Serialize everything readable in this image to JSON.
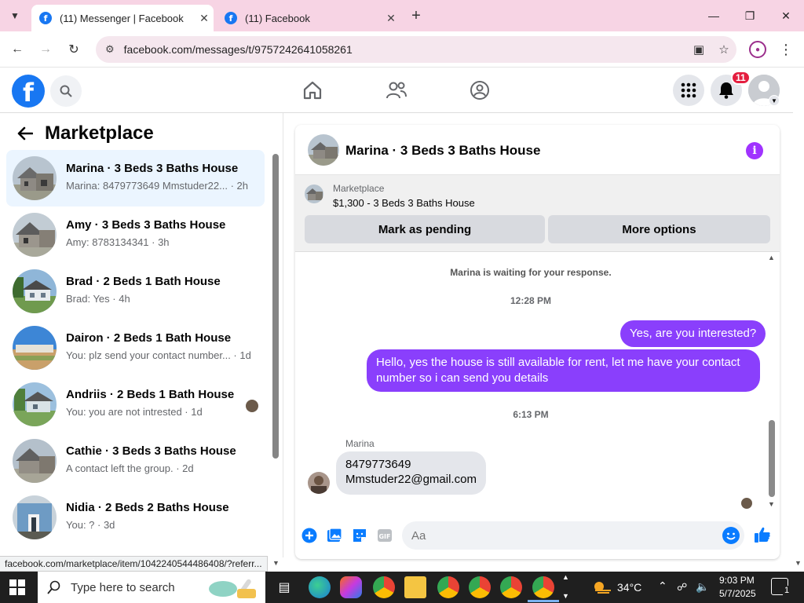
{
  "browser": {
    "tabs": [
      {
        "title": "(11) Messenger | Facebook",
        "active": true
      },
      {
        "title": "(11) Facebook",
        "active": false
      }
    ],
    "url": "facebook.com/messages/t/9757242641058261",
    "status_url": "facebook.com/marketplace/item/1042240544486408/?referr..."
  },
  "facebook": {
    "notification_count": "11"
  },
  "left_panel": {
    "title": "Marketplace",
    "conversations": [
      {
        "title": "Marina · 3 Beds 3 Baths House",
        "preview": "Marina: 8479773649 Mmstuder22... · 2h",
        "selected": true
      },
      {
        "title": "Amy · 3 Beds 3 Baths House",
        "preview": "Amy: 8783134341 · 3h"
      },
      {
        "title": "Brad · 2 Beds 1 Bath House",
        "preview": "Brad: Yes · 4h"
      },
      {
        "title": "Dairon · 2 Beds 1 Bath House",
        "preview": "You: plz send your contact number... · 1d"
      },
      {
        "title": "Andriis · 2 Beds 1 Bath House",
        "preview": "You: you are not intrested · 1d"
      },
      {
        "title": "Cathie · 3 Beds 3 Baths House",
        "preview": "A contact left the group. · 2d"
      },
      {
        "title": "Nidia · 2 Beds 2 Baths House",
        "preview": "You: ? · 3d"
      }
    ]
  },
  "chat": {
    "title": "Marina · 3 Beds 3 Baths House",
    "marketplace_label": "Marketplace",
    "listing": "$1,300 - 3 Beds 3 Baths House",
    "mark_pending": "Mark as pending",
    "more_options": "More options",
    "waiting": "Marina is waiting for your response.",
    "time1": "12:28 PM",
    "out_msg1": "Yes, are you interested?",
    "out_msg2": "Hello, yes the house is still available for rent, let me have your contact number so i can send you  details",
    "time2": "6:13 PM",
    "sender": "Marina",
    "in_msg_line1": "8479773649",
    "in_msg_line2": "Mmstuder22@gmail.com",
    "composer_placeholder": "Aa"
  },
  "taskbar": {
    "search_placeholder": "Type here to search",
    "temperature": "34°C",
    "time": "9:03 PM",
    "date": "5/7/2025",
    "notification_count": "1"
  },
  "colors": {
    "accent_purple": "#8a3ffc",
    "facebook_blue": "#1877f2",
    "selected_row": "#ebf5ff",
    "tab_strip": "#f7d4e4"
  }
}
